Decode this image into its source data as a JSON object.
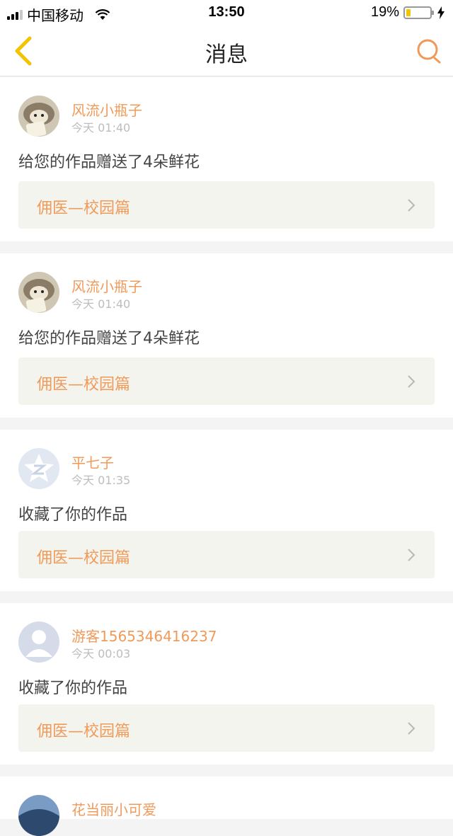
{
  "status_bar": {
    "carrier": "中国移动",
    "time": "13:50",
    "battery": "19%",
    "battery_level": 0.19
  },
  "header": {
    "title": "消息"
  },
  "colors": {
    "accent": "#f09a5a",
    "back_icon": "#f2c400",
    "card_bg": "#ffffff",
    "work_bg": "#f4f4ee"
  },
  "notifications": [
    {
      "username": "风流小瓶子",
      "time": "今天 01:40",
      "action": "给您的作品赠送了4朵鲜花",
      "work_title": "佣医—校园篇",
      "avatar": "hedgehog-avatar"
    },
    {
      "username": "风流小瓶子",
      "time": "今天 01:40",
      "action": "给您的作品赠送了4朵鲜花",
      "work_title": "佣医—校园篇",
      "avatar": "hedgehog-avatar"
    },
    {
      "username": "平七子",
      "time": "今天 01:35",
      "action": "收藏了你的作品",
      "work_title": "佣医—校园篇",
      "avatar": "qzone-avatar"
    },
    {
      "username": "游客1565346416237",
      "time": "今天 00:03",
      "action": "收藏了你的作品",
      "work_title": "佣医—校园篇",
      "avatar": "default-user-avatar"
    },
    {
      "username": "花当丽小可爱",
      "time": "",
      "action": "",
      "work_title": "",
      "avatar": "photo-avatar"
    }
  ]
}
